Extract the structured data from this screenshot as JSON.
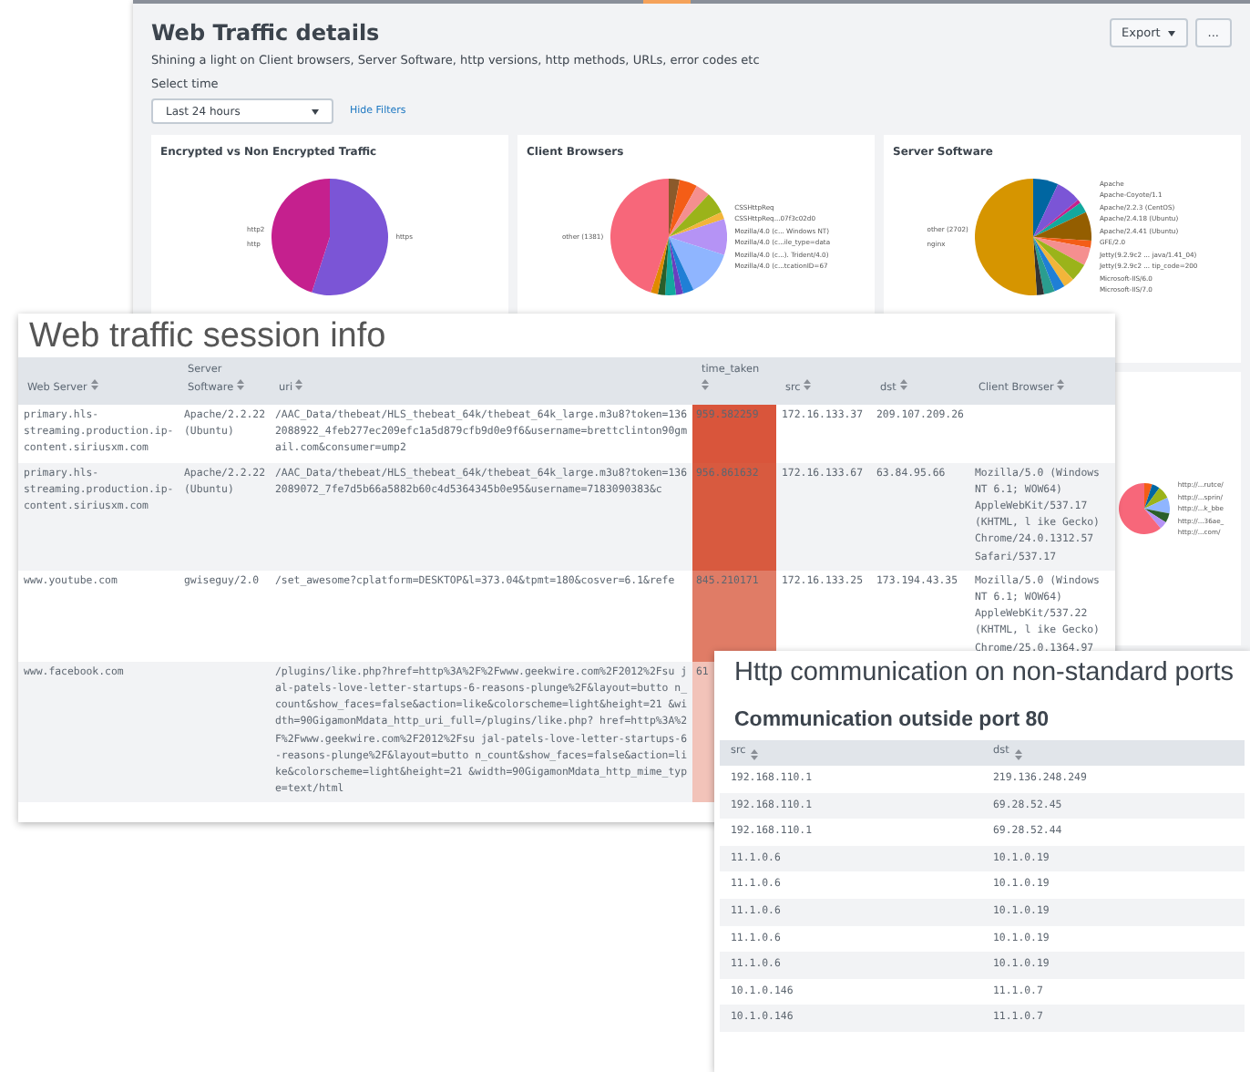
{
  "dashboard": {
    "title": "Web Traffic details",
    "description": "Shining a light on Client browsers, Server Software, http versions, http methods, URLs, error codes etc",
    "export_button": "Export",
    "more_button": "...",
    "time_label": "Select time",
    "time_picker": {
      "value": "Last 24 hours"
    },
    "hide_filters": "Hide Filters",
    "panels": [
      {
        "title": "Encrypted vs Non Encrypted Traffic",
        "left_labels": [
          "http2",
          "http"
        ],
        "right_labels": [
          "https"
        ]
      },
      {
        "title": "Client Browsers",
        "left_labels": [
          "other (1381)"
        ],
        "right_labels": [
          "CSSHttpReq",
          "CSSHttpReq...07f3c02d0",
          "Mozilla/4.0 (c... Windows NT)",
          "Mozilla/4.0 (c...ile_type=data",
          "Mozilla/4.0 (c...). Trident/4.0)",
          "Mozilla/4.0 (c...tcationID=67"
        ]
      },
      {
        "title": "Server Software",
        "left_labels": [
          "other (2702)",
          "nginx"
        ],
        "right_labels": [
          "Apache",
          "Apache-Coyote/1.1",
          "Apache/2.2.3 (CentOS)",
          "Apache/2.4.18 (Ubuntu)",
          "Apache/2.4.41 (Ubuntu)",
          "GFE/2.0",
          "Jetty(9.2.9c2 ... java/1.41_04)",
          "Jetty(9.2.9c2 ... tip_code=200",
          "Microsoft-IIS/6.0",
          "Microsoft-IIS/7.0"
        ]
      },
      {
        "right_labels": [
          "http://...rutce/",
          "http://...sprin/",
          "http://...k_bbe",
          "http://...36ae_",
          "http://...com/"
        ]
      }
    ]
  },
  "session": {
    "title": "Web traffic session info",
    "columns": [
      "Web Server",
      "Server Software",
      "uri",
      "time_taken",
      "src",
      "dst",
      "Client Browser"
    ],
    "rows": [
      {
        "web_server": "primary.hls-streaming.production.ip-content.siriusxm.com",
        "server_software": "Apache/2.2.22 (Ubuntu)",
        "uri": "/AAC_Data/thebeat/HLS_thebeat_64k/thebeat_64k_large.m3u8?token=1362088922_4feb277ec209efc1a5d879cfb9d0e9f6&username=brettclinton90gmail.com&consumer=ump2",
        "time_taken": {
          "text": "959.582259",
          "color": "#d9553b"
        },
        "src": "172.16.133.37",
        "dst": "209.107.209.26",
        "client_browser": ""
      },
      {
        "web_server": "primary.hls-streaming.production.ip-content.siriusxm.com",
        "server_software": "Apache/2.2.22 (Ubuntu)",
        "uri": "/AAC_Data/thebeat/HLS_thebeat_64k/thebeat_64k_large.m3u8?token=1362089072_7fe7d5b66a5882b60c4d5364345b0e95&username=7183090383&c",
        "time_taken": {
          "text": "956.861632",
          "color": "#d85a3f"
        },
        "src": "172.16.133.67",
        "dst": "63.84.95.66",
        "client_browser": "Mozilla/5.0 (Windows NT 6.1; WOW64) AppleWebKit/537.17 (KHTML, l ike Gecko) Chrome/24.0.1312.57 Safari/537.17"
      },
      {
        "web_server": "www.youtube.com",
        "server_software": "gwiseguy/2.0",
        "uri": "/set_awesome?cplatform=DESKTOP&l=373.04&tpmt=180&cosver=6.1&refe",
        "time_taken": {
          "text": "845.210171",
          "color": "#e07c66"
        },
        "src": "172.16.133.25",
        "dst": "173.194.43.35",
        "client_browser": "Mozilla/5.0 (Windows NT 6.1; WOW64) AppleWebKit/537.22 (KHTML, l ike Gecko) Chrome/25.0.1364.97"
      },
      {
        "web_server": "www.facebook.com",
        "server_software": "",
        "uri": "/plugins/like.php?href=http%3A%2F%2Fwww.geekwire.com%2F2012%2Fsu jal-patels-love-letter-startups-6-reasons-plunge%2F&layout=butto n_count&show_faces=false&action=like&colorscheme=light&height=21 &width=90GigamonMdata_http_uri_full=/plugins/like.php? href=http%3A%2F%2Fwww.geekwire.com%2F2012%2Fsu jal-patels-love-letter-startups-6-reasons-plunge%2F&layout=butto n_count&show_faces=false&action=like&colorscheme=light&height=21 &width=90GigamonMdata_http_mime_type=text/html",
        "time_taken": {
          "text": "61",
          "color": "#f2c3b9"
        },
        "src": "",
        "dst": "",
        "client_browser": ""
      }
    ]
  },
  "ports": {
    "title": "Http communication on non-standard ports",
    "subtitle": "Communication outside port 80",
    "columns": [
      "src",
      "dst"
    ],
    "rows": [
      {
        "src": "192.168.110.1",
        "dst": "219.136.248.249"
      },
      {
        "src": "192.168.110.1",
        "dst": "69.28.52.45"
      },
      {
        "src": "192.168.110.1",
        "dst": "69.28.52.44"
      },
      {
        "src": "11.1.0.6",
        "dst": "10.1.0.19"
      },
      {
        "src": "11.1.0.6",
        "dst": "10.1.0.19"
      },
      {
        "src": "11.1.0.6",
        "dst": "10.1.0.19"
      },
      {
        "src": "11.1.0.6",
        "dst": "10.1.0.19"
      },
      {
        "src": "11.1.0.6",
        "dst": "10.1.0.19"
      },
      {
        "src": "10.1.0.146",
        "dst": "11.1.0.7"
      },
      {
        "src": "10.1.0.146",
        "dst": "11.1.0.7"
      }
    ]
  }
}
